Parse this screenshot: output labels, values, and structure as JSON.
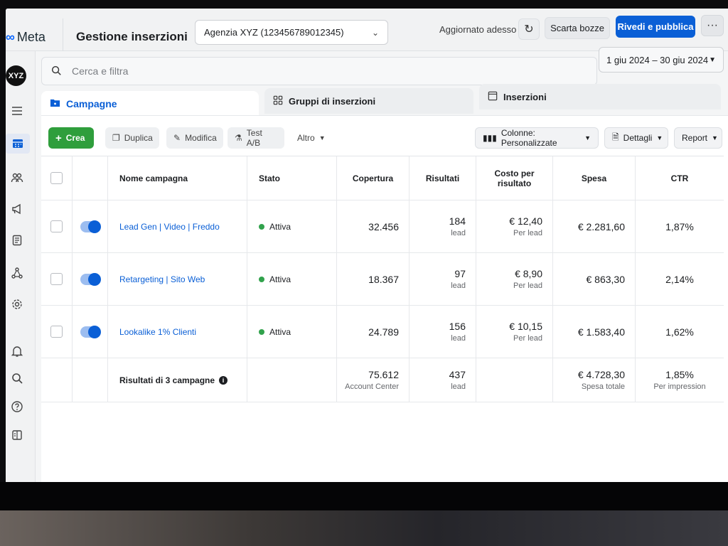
{
  "header": {
    "logo_mark": "∞",
    "logo_text": "Meta",
    "title": "Gestione inserzioni",
    "account": "Agenzia XYZ (123456789012345)",
    "updated": "Aggiornato adesso",
    "discard_label": "Scarta bozze",
    "publish_label": "Rivedi e pubblica",
    "more_label": "···"
  },
  "sidebar": {
    "avatar": "XYZ",
    "items": [
      "menu-icon",
      "campaigns-icon",
      "audience-icon",
      "megaphone-icon",
      "reports-icon",
      "integrations-icon",
      "settings-icon",
      "notifications-icon",
      "search-icon",
      "help-icon",
      "panel-icon"
    ]
  },
  "search": {
    "placeholder": "Cerca e filtra"
  },
  "date_range": "1 giu 2024 – 30 giu 2024",
  "tabs": {
    "campaigns": "Campagne",
    "adsets": "Gruppi di inserzioni",
    "ads": "Inserzioni"
  },
  "toolbar": {
    "create": "Crea",
    "duplicate": "Duplica",
    "edit": "Modifica",
    "ab_test": "Test A/B",
    "more": "Altro",
    "columns": "Colonne: Personalizzate",
    "breakdown": "Dettagli",
    "reports": "Report"
  },
  "table": {
    "headers": {
      "name": "Nome campagna",
      "status": "Stato",
      "reach": "Copertura",
      "results": "Risultati",
      "cost_line1": "Costo per",
      "cost_line2": "risultato",
      "spend": "Spesa",
      "ctr": "CTR"
    },
    "rows": [
      {
        "name": "Lead Gen | Video | Freddo",
        "status": "Attiva",
        "reach": "32.456",
        "results": "184",
        "results_unit": "lead",
        "cost": "€ 12,40",
        "cost_unit": "Per lead",
        "spend": "€ 2.281,60",
        "ctr": "1,87%"
      },
      {
        "name": "Retargeting | Sito Web",
        "status": "Attiva",
        "reach": "18.367",
        "results": "97",
        "results_unit": "lead",
        "cost": "€ 8,90",
        "cost_unit": "Per lead",
        "spend": "€ 863,30",
        "ctr": "2,14%"
      },
      {
        "name": "Lookalike 1% Clienti",
        "status": "Attiva",
        "reach": "24.789",
        "results": "156",
        "results_unit": "lead",
        "cost": "€ 10,15",
        "cost_unit": "Per lead",
        "spend": "€ 1.583,40",
        "ctr": "1,62%"
      }
    ],
    "summary": {
      "label": "Risultati di 3 campagne",
      "reach": "75.612",
      "reach_unit": "Account Center",
      "results": "437",
      "results_unit": "lead",
      "spend": "€ 4.728,30",
      "spend_unit": "Spesa totale",
      "ctr": "1,85%",
      "ctr_unit": "Per impression"
    }
  },
  "colors": {
    "accent": "#0a5fd6",
    "create": "#2f9e3c",
    "active": "#31a24c"
  }
}
